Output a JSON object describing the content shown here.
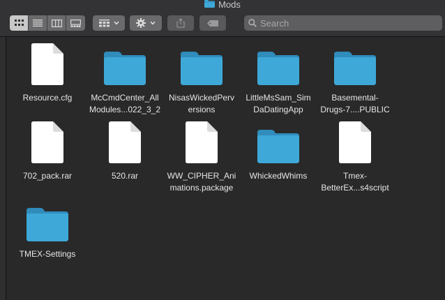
{
  "window": {
    "title": "Mods"
  },
  "toolbar": {
    "view_modes": [
      "icon-view",
      "list-view",
      "column-view",
      "gallery-view"
    ],
    "active_view": "icon-view",
    "search": {
      "placeholder": "Search",
      "value": ""
    }
  },
  "colors": {
    "folder": "#3ea8d8",
    "folder_tab": "#2f8cbb",
    "document": "#ffffff",
    "background": "#292929"
  },
  "files": {
    "items": [
      {
        "kind": "document",
        "line1": "Resource.cfg",
        "line2": ""
      },
      {
        "kind": "folder",
        "line1": "McCmdCenter_All",
        "line2": "Modules...022_3_2"
      },
      {
        "kind": "folder",
        "line1": "NisasWickedPerv",
        "line2": "ersions"
      },
      {
        "kind": "folder",
        "line1": "LittleMsSam_Sim",
        "line2": "DaDatingApp"
      },
      {
        "kind": "folder",
        "line1": "Basemental-",
        "line2": "Drugs-7....PUBLIC"
      },
      {
        "kind": "document",
        "line1": "702_pack.rar",
        "line2": ""
      },
      {
        "kind": "document",
        "line1": "520.rar",
        "line2": ""
      },
      {
        "kind": "document",
        "line1": "WW_CIPHER_Ani",
        "line2": "mations.package"
      },
      {
        "kind": "folder",
        "line1": "WhickedWhims",
        "line2": ""
      },
      {
        "kind": "document",
        "line1": "Tmex-",
        "line2": "BetterEx...s4script"
      },
      {
        "kind": "folder",
        "line1": "TMEX-Settings",
        "line2": ""
      }
    ]
  }
}
